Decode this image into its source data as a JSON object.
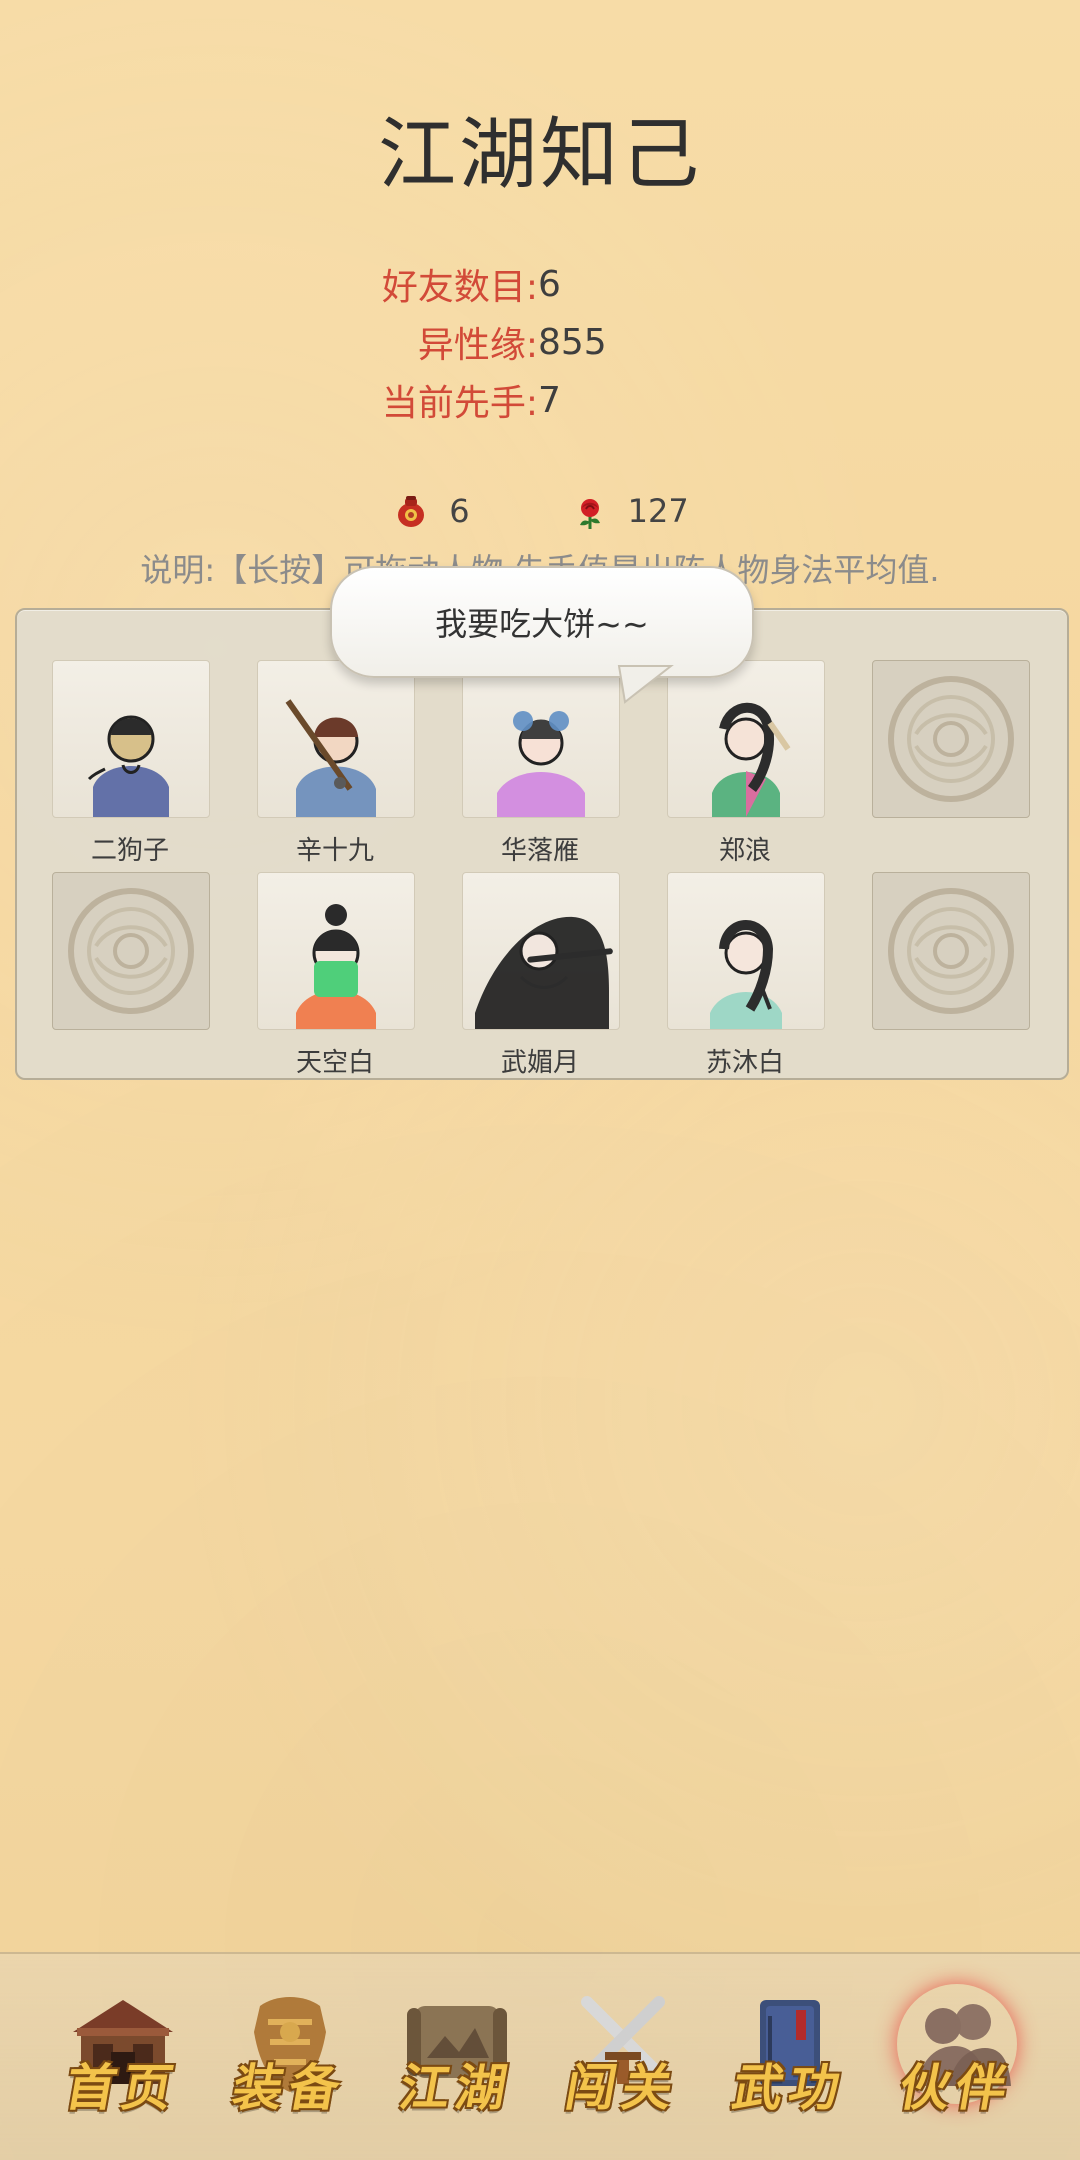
{
  "page": {
    "title": "江湖知己"
  },
  "stats": [
    {
      "label": "好友数目:",
      "value": "6"
    },
    {
      "label": "异性缘:",
      "value": "855"
    },
    {
      "label": "当前先手:",
      "value": "7"
    }
  ],
  "resources": {
    "wine": {
      "value": "6",
      "icon": "wine-jar-icon"
    },
    "rose": {
      "value": "127",
      "icon": "rose-icon"
    }
  },
  "note": "说明:【长按】可拖动人物,先手值是出阵人物身法平均值.",
  "bubble": {
    "text": "我要吃大饼~~"
  },
  "friends": [
    {
      "name": "二狗子",
      "icon": "portrait-ergouzi"
    },
    {
      "name": "辛十九",
      "icon": "portrait-xinshijiu"
    },
    {
      "name": "华落雁",
      "icon": "portrait-hualuoyan"
    },
    {
      "name": "郑浪",
      "icon": "portrait-zhenglang"
    },
    {
      "name": "",
      "icon": "empty-slot-emblem"
    },
    {
      "name": "",
      "icon": "empty-slot-emblem"
    },
    {
      "name": "天空白",
      "icon": "portrait-tiankongbai"
    },
    {
      "name": "武媚月",
      "icon": "portrait-wumeiyue"
    },
    {
      "name": "苏沐白",
      "icon": "portrait-sumubai"
    },
    {
      "name": "",
      "icon": "empty-slot-emblem"
    }
  ],
  "nav": [
    {
      "label": "首页",
      "icon": "home-pavilion-icon",
      "active": false
    },
    {
      "label": "装备",
      "icon": "armor-icon",
      "active": false
    },
    {
      "label": "江湖",
      "icon": "scroll-map-icon",
      "active": false
    },
    {
      "label": "闯关",
      "icon": "crossed-swords-icon",
      "active": false
    },
    {
      "label": "武功",
      "icon": "martial-book-icon",
      "active": false
    },
    {
      "label": "伙伴",
      "icon": "partners-icon",
      "active": true
    }
  ],
  "colors": {
    "accent_red": "#d24a38",
    "nav_gold": "#f3c34b"
  }
}
